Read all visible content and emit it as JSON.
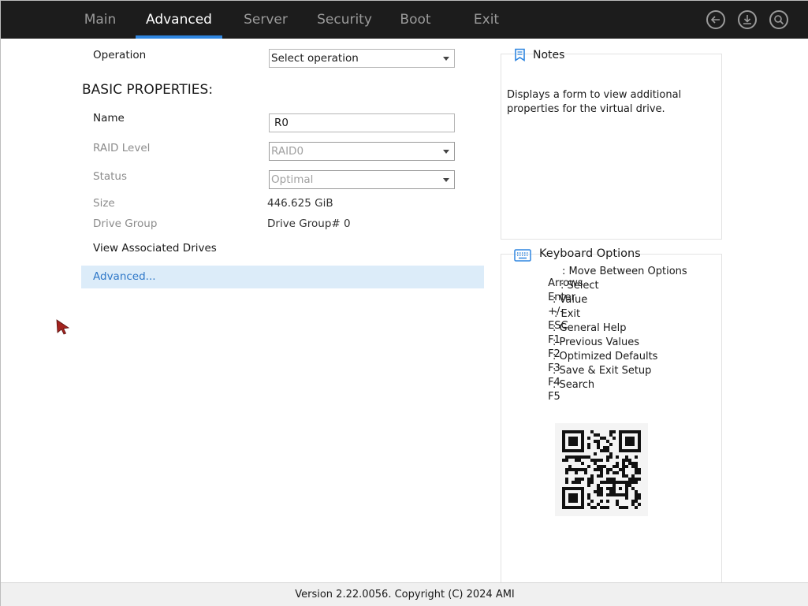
{
  "tabs": [
    {
      "label": "Main"
    },
    {
      "label": "Advanced"
    },
    {
      "label": "Server"
    },
    {
      "label": "Security"
    },
    {
      "label": "Boot"
    },
    {
      "label": "Exit"
    }
  ],
  "active_tab": "Advanced",
  "toolbar_icons": [
    "back-icon",
    "save-download-icon",
    "search-icon"
  ],
  "operation": {
    "label": "Operation",
    "value": "Select operation"
  },
  "section_heading": "BASIC PROPERTIES:",
  "fields": {
    "name": {
      "label": "Name",
      "value": "R0"
    },
    "raid_level": {
      "label": "RAID Level",
      "value": "RAID0"
    },
    "status": {
      "label": "Status",
      "value": "Optimal"
    },
    "size": {
      "label": "Size",
      "value": "446.625 GiB"
    },
    "drive_group": {
      "label": "Drive Group",
      "value": "Drive Group# 0"
    }
  },
  "view_associated_drives": "View Associated Drives",
  "advanced_link": "Advanced...",
  "notes": {
    "title": "Notes",
    "text": "Displays a form to view additional properties for the virtual drive."
  },
  "keyboard": {
    "title": "Keyboard Options",
    "rows": [
      {
        "key": "Arrows",
        "desc": ": Move Between Options"
      },
      {
        "key": "Enter",
        "desc": ": Select"
      },
      {
        "key": "+/-",
        "desc": ": Value"
      },
      {
        "key": "ESC",
        "desc": ": Exit"
      },
      {
        "key": "F1",
        "desc": ": General Help"
      },
      {
        "key": "F2",
        "desc": ": Previous Values"
      },
      {
        "key": "F3",
        "desc": ": Optimized Defaults"
      },
      {
        "key": "F4",
        "desc": ": Save & Exit Setup"
      },
      {
        "key": "F5",
        "desc": ": Search"
      }
    ]
  },
  "footer": "Version 2.22.0056. Copyright (C) 2024 AMI",
  "colors": {
    "topbar": "#1c1c1c",
    "accent": "#2f86e0",
    "highlight": "#dcecf9",
    "link": "#2f78c8",
    "cursor": "#a3231f"
  }
}
